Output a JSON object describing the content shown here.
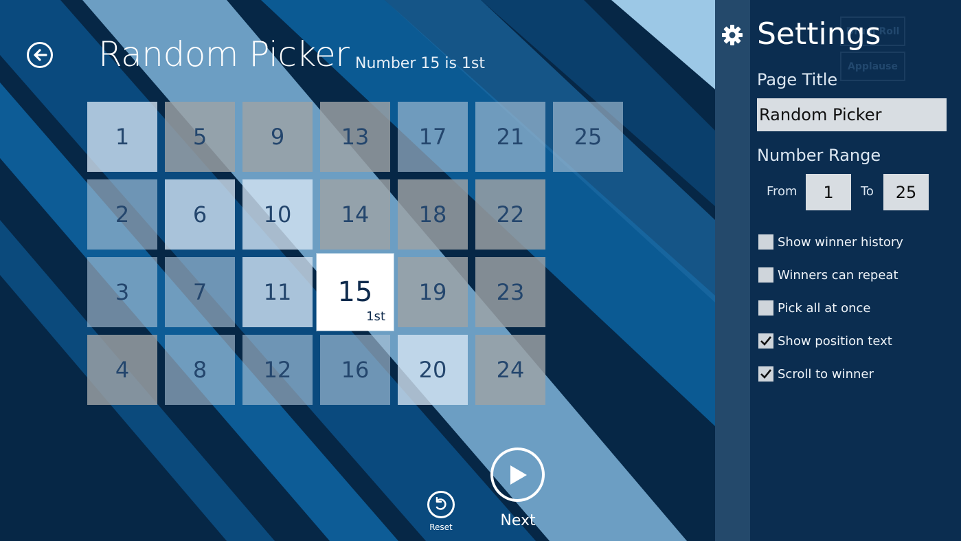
{
  "page": {
    "title": "Random Picker",
    "subtitle": "Number 15 is 1st"
  },
  "tiles": [
    {
      "n": "1",
      "shade": "lt"
    },
    {
      "n": "5",
      "shade": "dk"
    },
    {
      "n": "9",
      "shade": "dk"
    },
    {
      "n": "13",
      "shade": "dk"
    },
    {
      "n": "17",
      "shade": "md"
    },
    {
      "n": "21",
      "shade": "md"
    },
    {
      "n": "25",
      "shade": "md"
    },
    {
      "n": "2",
      "shade": "md"
    },
    {
      "n": "6",
      "shade": "lt"
    },
    {
      "n": "10",
      "shade": "lt"
    },
    {
      "n": "14",
      "shade": "dk"
    },
    {
      "n": "18",
      "shade": "dk"
    },
    {
      "n": "22",
      "shade": "dk"
    },
    {
      "n": "3",
      "shade": "md"
    },
    {
      "n": "7",
      "shade": "md"
    },
    {
      "n": "11",
      "shade": "lt"
    },
    {
      "n": "15",
      "shade": "win",
      "position": "1st"
    },
    {
      "n": "19",
      "shade": "dk"
    },
    {
      "n": "23",
      "shade": "dk"
    },
    {
      "n": "4",
      "shade": "dk"
    },
    {
      "n": "8",
      "shade": "md"
    },
    {
      "n": "12",
      "shade": "md"
    },
    {
      "n": "16",
      "shade": "md"
    },
    {
      "n": "20",
      "shade": "lt"
    },
    {
      "n": "24",
      "shade": "dk"
    }
  ],
  "controls": {
    "reset_label": "Reset",
    "next_label": "Next"
  },
  "settings": {
    "title": "Settings",
    "ghost_buttons": [
      "Drum Roll",
      "Applause"
    ],
    "page_title_label": "Page Title",
    "page_title_value": "Random Picker",
    "range_label": "Number Range",
    "from_label": "From",
    "from_value": "1",
    "to_label": "To",
    "to_value": "25",
    "options": [
      {
        "label": "Show winner history",
        "checked": false
      },
      {
        "label": "Winners can repeat",
        "checked": false
      },
      {
        "label": "Pick all at once",
        "checked": false
      },
      {
        "label": "Show position text",
        "checked": true
      },
      {
        "label": "Scroll to winner",
        "checked": true
      }
    ]
  },
  "colors": {
    "background": "#062746",
    "settings_panel": "#0b2d50",
    "settings_strip": "#24496b",
    "stripe_light": "#86b9dc",
    "stripe_mid": "#0b5a93"
  }
}
